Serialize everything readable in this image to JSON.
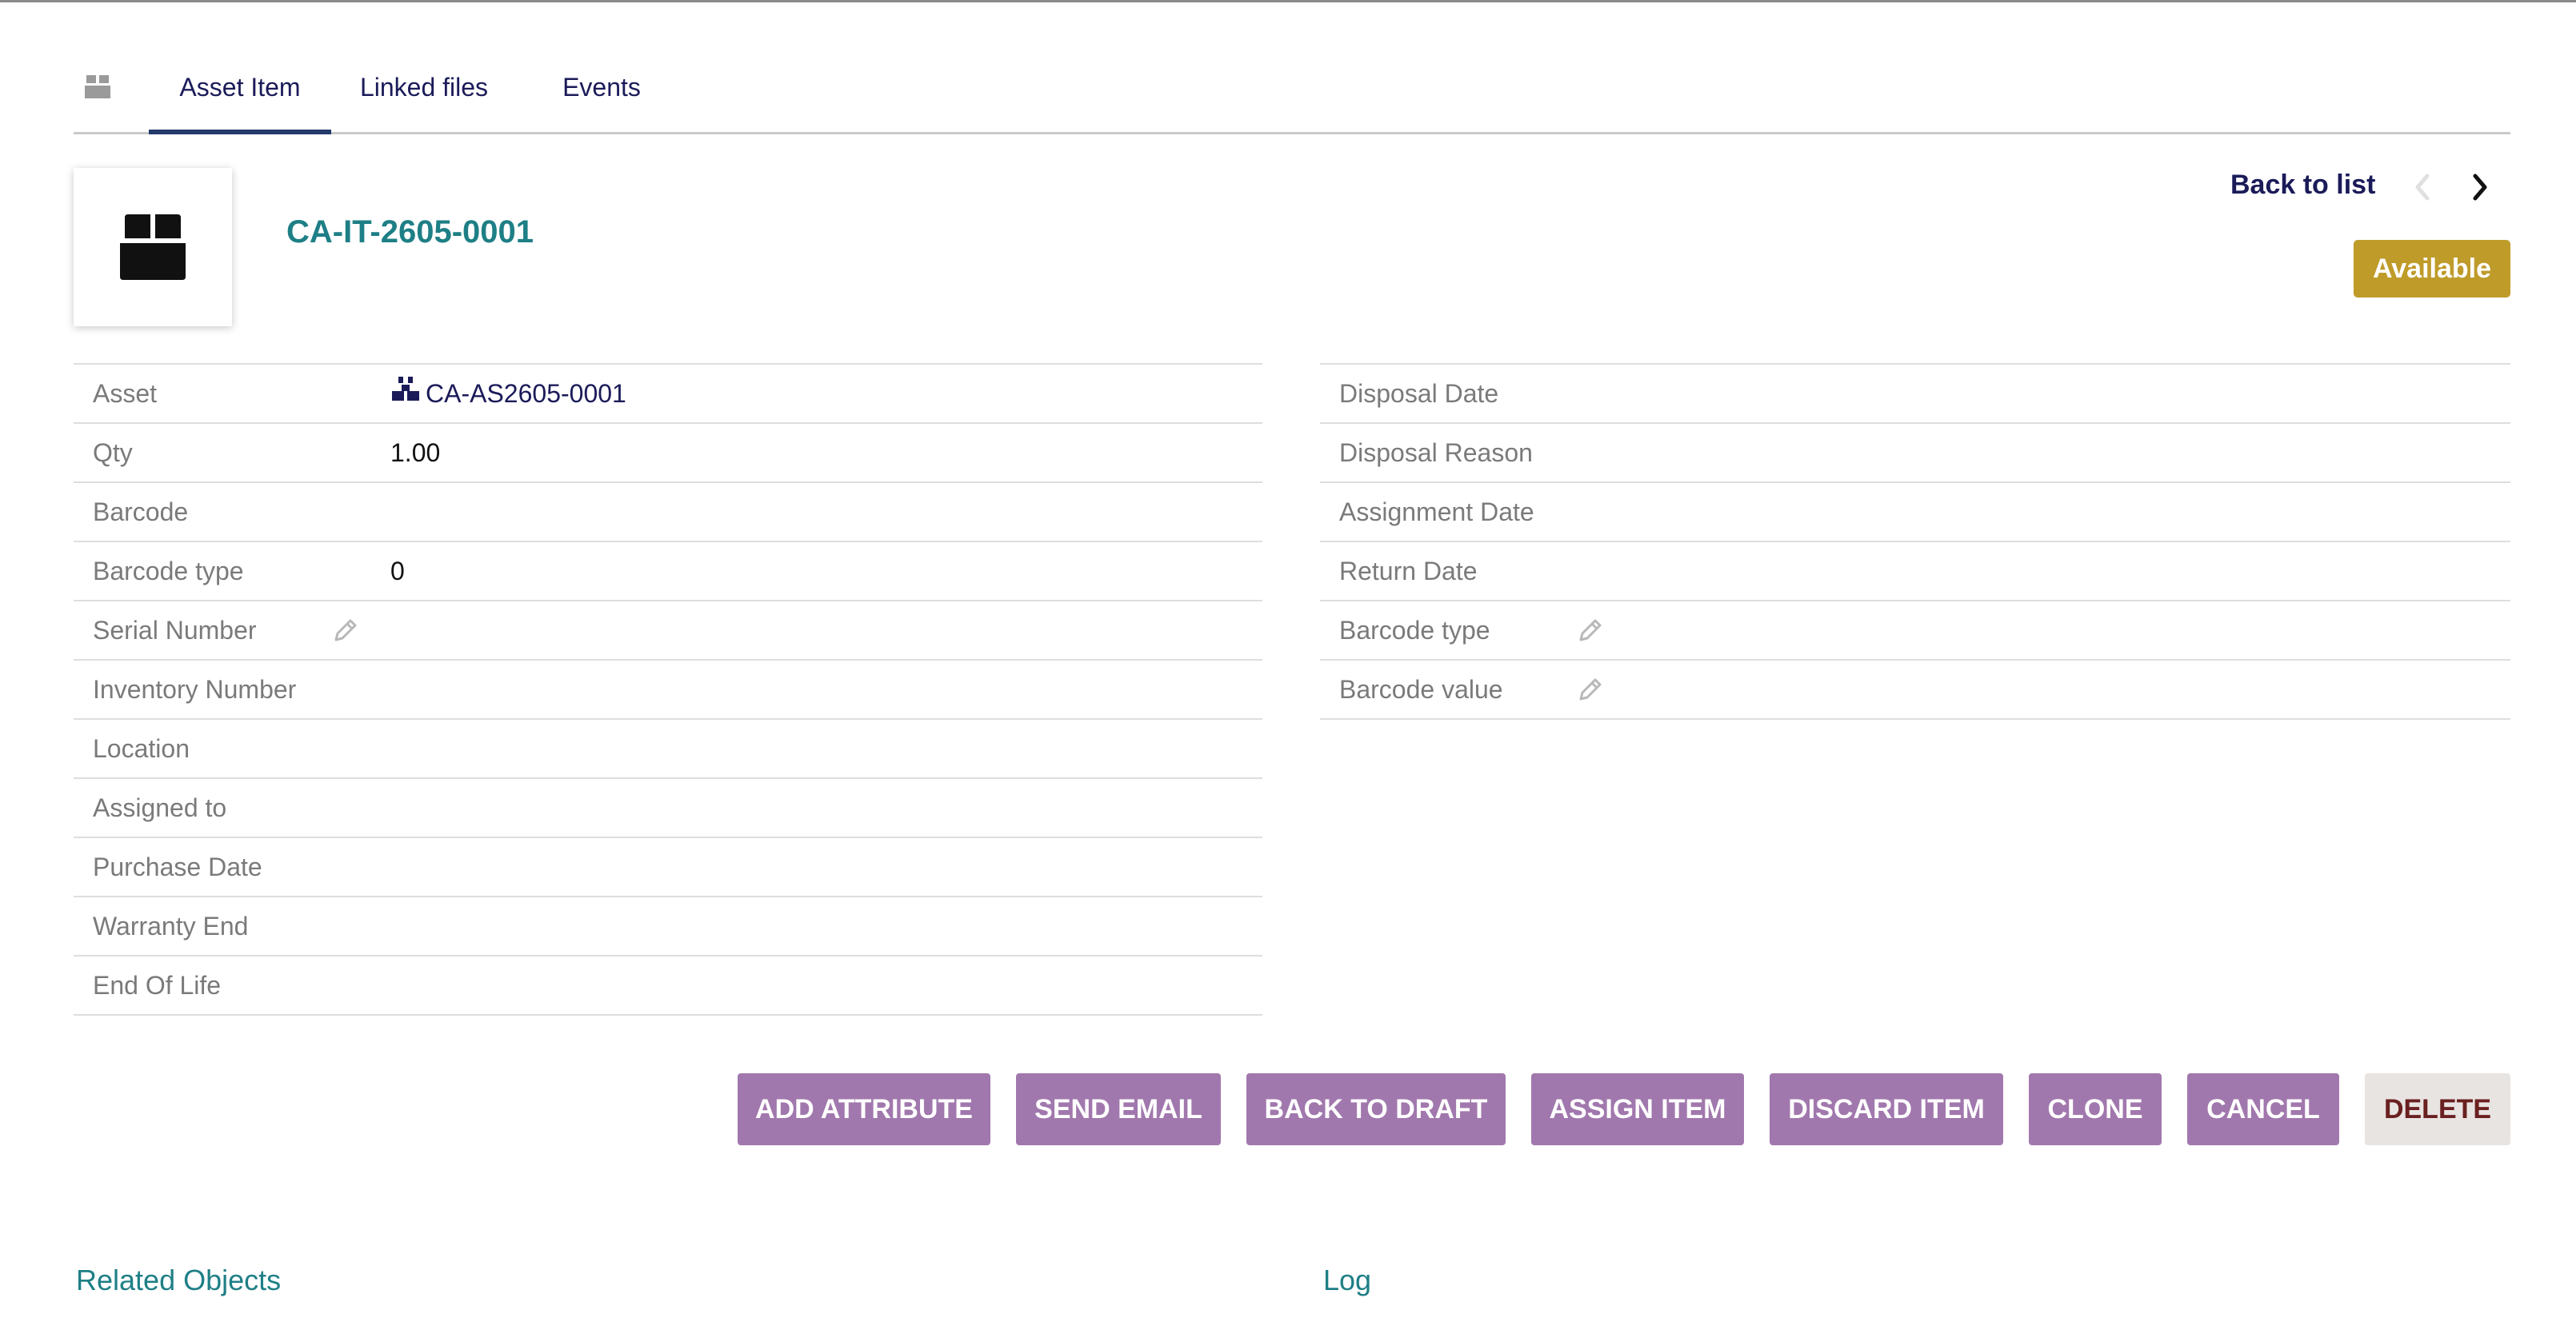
{
  "tabs": [
    {
      "label": "Asset Item",
      "active": true
    },
    {
      "label": "Linked files",
      "active": false
    },
    {
      "label": "Events",
      "active": false
    }
  ],
  "header": {
    "ref": "CA-IT-2605-0001",
    "back_label": "Back to list",
    "status": "Available",
    "status_color": "#bf9b2a",
    "icon": "box-icon"
  },
  "left_fields": [
    {
      "label": "Asset",
      "value": "CA-AS2605-0001",
      "icon": "asset-link-icon"
    },
    {
      "label": "Qty",
      "value": "1.00"
    },
    {
      "label": "Barcode",
      "value": ""
    },
    {
      "label": "Barcode type",
      "value": "0"
    },
    {
      "label": "Serial Number",
      "value": "",
      "editable": true
    },
    {
      "label": "Inventory Number",
      "value": ""
    },
    {
      "label": "Location",
      "value": ""
    },
    {
      "label": "Assigned to",
      "value": ""
    },
    {
      "label": "Purchase Date",
      "value": ""
    },
    {
      "label": "Warranty End",
      "value": ""
    },
    {
      "label": "End Of Life",
      "value": ""
    }
  ],
  "right_fields": [
    {
      "label": "Disposal Date",
      "value": ""
    },
    {
      "label": "Disposal Reason",
      "value": ""
    },
    {
      "label": "Assignment Date",
      "value": ""
    },
    {
      "label": "Return Date",
      "value": ""
    },
    {
      "label": "Barcode type",
      "value": "",
      "editable": true
    },
    {
      "label": "Barcode value",
      "value": "",
      "editable": true
    }
  ],
  "actions": {
    "add_attribute": "ADD ATTRIBUTE",
    "send_email": "SEND EMAIL",
    "back_to_draft": "BACK TO DRAFT",
    "assign_item": "ASSIGN ITEM",
    "discard_item": "DISCARD ITEM",
    "clone": "CLONE",
    "cancel": "CANCEL",
    "delete": "DELETE"
  },
  "sections": {
    "related": "Related Objects",
    "log": "Log"
  },
  "colors": {
    "accent_teal": "#1e7f86",
    "button_purple": "#a178ad",
    "navy_text": "#1b1b5a"
  }
}
